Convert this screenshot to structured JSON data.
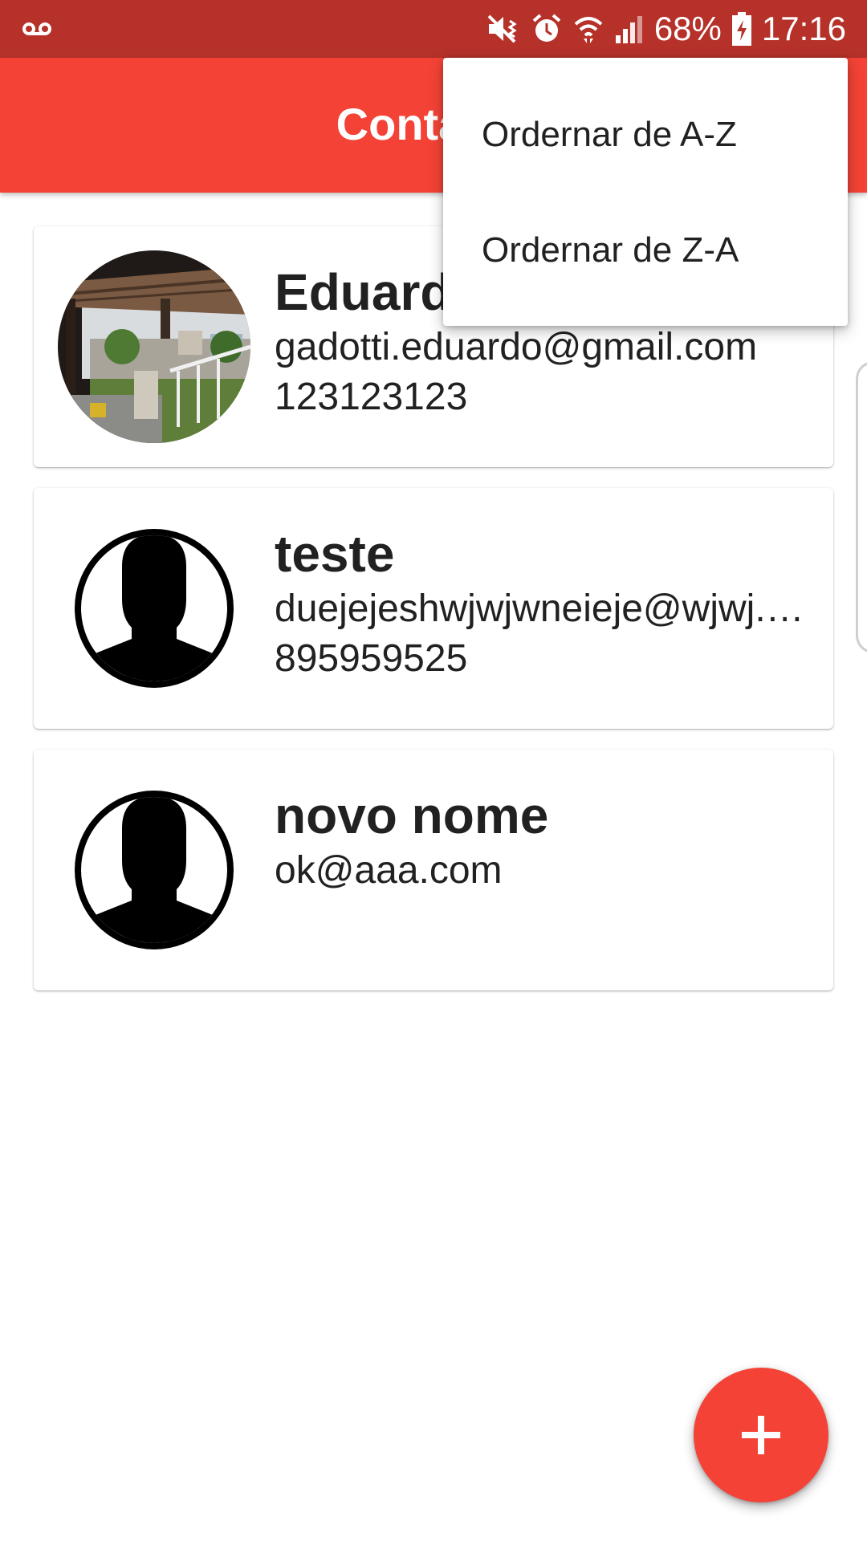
{
  "status_bar": {
    "battery_percent": "68%",
    "time": "17:16",
    "icons": [
      "voicemail-icon",
      "mute-vibrate-icon",
      "alarm-icon",
      "wifi-icon",
      "signal-icon",
      "battery-charging-icon"
    ]
  },
  "app_bar": {
    "title": "Contatos",
    "color": "#f44336"
  },
  "overflow_menu": {
    "items": [
      {
        "label": "Ordernar de A-Z"
      },
      {
        "label": "Ordernar de Z-A"
      }
    ]
  },
  "contacts": [
    {
      "name": "Eduardo",
      "email": "gadotti.eduardo@gmail.com",
      "phone": "123123123",
      "avatar": "photo"
    },
    {
      "name": "teste",
      "email": "duejejeshwjwjwneieje@wjwj.com",
      "phone": "895959525",
      "avatar": "default-person-icon"
    },
    {
      "name": "novo nome",
      "email": "ok@aaa.com",
      "phone": "",
      "avatar": "default-person-icon"
    }
  ],
  "fab": {
    "icon": "plus-icon",
    "color": "#f44336"
  }
}
